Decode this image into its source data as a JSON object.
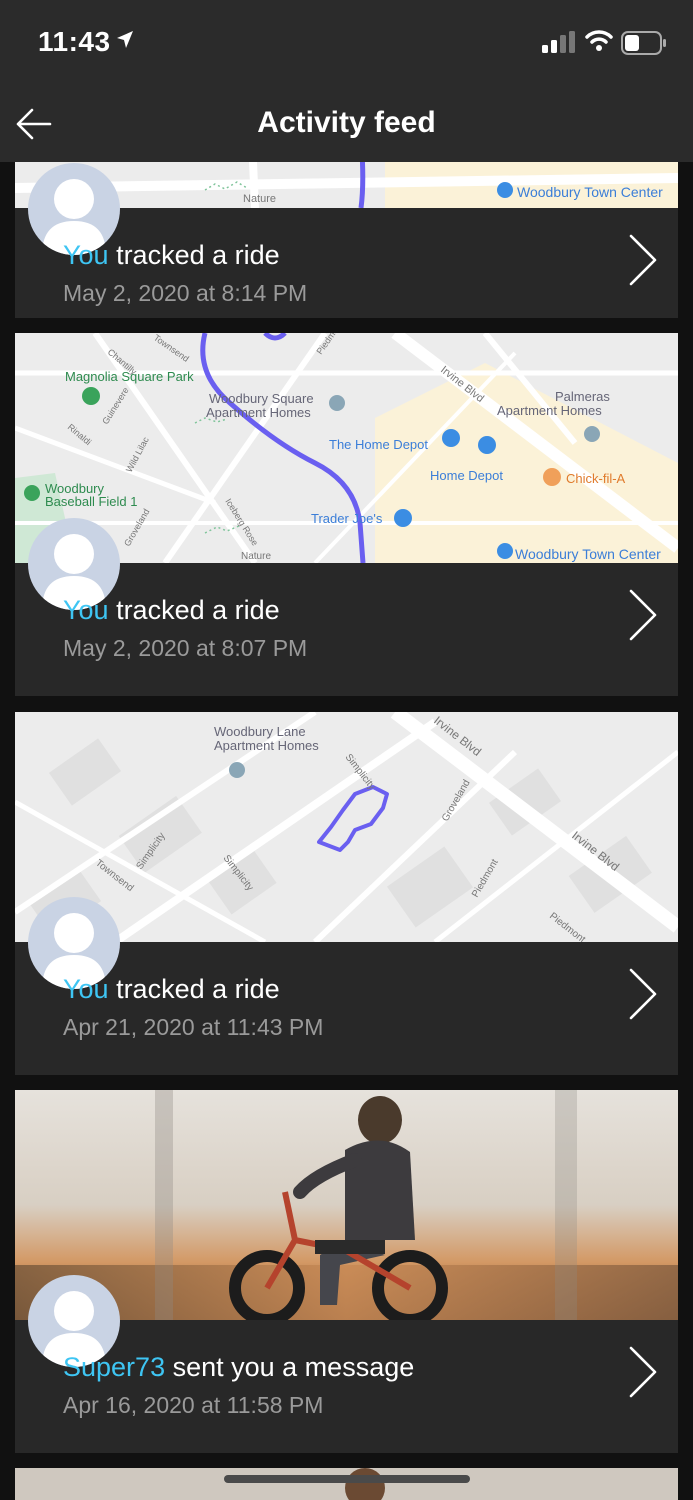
{
  "status_bar": {
    "time": "11:43"
  },
  "header": {
    "title": "Activity feed"
  },
  "cards": [
    {
      "actor": "You",
      "action": " tracked a ride",
      "timestamp": "May 2, 2020 at 8:14 PM",
      "map_labels": {
        "town_center": "Woodbury Town Center",
        "nature": "Nature"
      }
    },
    {
      "actor": "You",
      "action": " tracked a ride",
      "timestamp": "May 2, 2020 at 8:07 PM",
      "map_labels": {
        "magnolia": "Magnolia Square Park",
        "woodbury_square_1": "Woodbury Square",
        "woodbury_square_2": "Apartment Homes",
        "palmeras_1": "Palmeras",
        "palmeras_2": "Apartment Homes",
        "home_depot_1": "The Home Depot",
        "home_depot_2": "Home Depot",
        "chickfila": "Chick-fil-A",
        "baseball_1": "Woodbury",
        "baseball_2": "Baseball Field 1",
        "traderjoes": "Trader Joe's",
        "town_center": "Woodbury Town Center",
        "irvine": "Irvine Blvd",
        "chantilly": "Chantilly",
        "townsend": "Townsend",
        "piedmont": "Piedmont",
        "guinevere": "Guinevere",
        "rinaldi": "Rinaldi",
        "wildlilac": "Wild Lilac",
        "iceberg": "Iceberg Rose",
        "groveland": "Groveland",
        "nature": "Nature"
      }
    },
    {
      "actor": "You",
      "action": " tracked a ride",
      "timestamp": "Apr 21, 2020 at 11:43 PM",
      "map_labels": {
        "woodbury_lane_1": "Woodbury Lane",
        "woodbury_lane_2": "Apartment Homes",
        "irvine_1": "Irvine Blvd",
        "irvine_2": "Irvine Blvd",
        "simplicity_1": "Simplicity",
        "simplicity_2": "Simplicity",
        "simplicity_3": "Simplicity",
        "groveland": "Groveland",
        "piedmont_1": "Piedmont",
        "piedmont_2": "Piedmont",
        "townsend": "Townsend"
      }
    },
    {
      "actor": "Super73",
      "action": " sent you a message",
      "timestamp": "Apr 16, 2020 at 11:58 PM"
    }
  ],
  "colors": {
    "accent": "#3ec5f3",
    "route": "#6a5ff0",
    "card_bg": "#282828",
    "bar_bg": "#2b2b2b"
  },
  "icons": [
    "back-arrow-icon",
    "location-arrow-icon",
    "signal-icon",
    "wifi-icon",
    "battery-icon",
    "chevron-right-icon",
    "avatar-placeholder-icon",
    "map-pin-icon"
  ]
}
